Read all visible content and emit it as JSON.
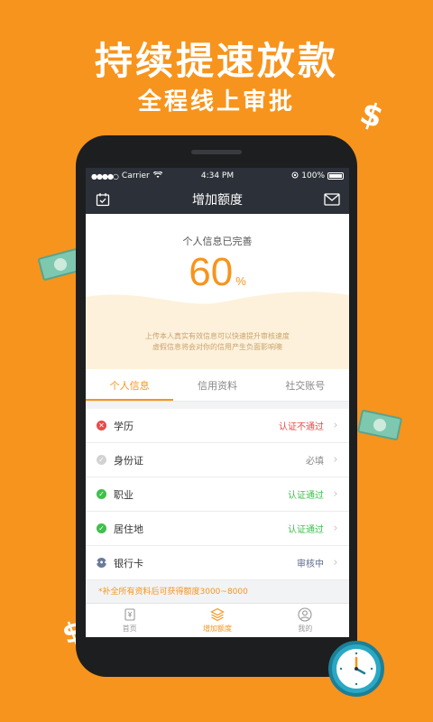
{
  "promo": {
    "headline": "持续提速放款",
    "subline": "全程线上审批"
  },
  "statusbar": {
    "signal": "●●●●○",
    "carrier": "Carrier",
    "time": "4:34 PM",
    "battery": "100%"
  },
  "navbar": {
    "title": "增加额度",
    "left_icon": "calendar-check-icon",
    "right_icon": "mail-icon"
  },
  "progress": {
    "label": "个人信息已完善",
    "value": "60",
    "unit": "%",
    "percent": 60,
    "hint_line1": "上传本人真实有效信息可以快速提升审核速度",
    "hint_line2": "虚假信息将会对你的信用产生负面影响噢"
  },
  "tabs": [
    {
      "label": "个人信息",
      "active": true
    },
    {
      "label": "信用资料",
      "active": false
    },
    {
      "label": "社交账号",
      "active": false
    }
  ],
  "items": [
    {
      "label": "学历",
      "status": "认证不通过",
      "status_color": "#e84a4a",
      "icon": "x-circle-icon",
      "icon_color": "#e84a4a"
    },
    {
      "label": "身份证",
      "status": "必填",
      "status_color": "#888888",
      "icon": "check-circle-icon",
      "icon_color": "#d2d2d2"
    },
    {
      "label": "职业",
      "status": "认证通过",
      "status_color": "#3fbf4b",
      "icon": "check-circle-icon",
      "icon_color": "#3fbf4b"
    },
    {
      "label": "居住地",
      "status": "认证通过",
      "status_color": "#3fbf4b",
      "icon": "check-circle-icon",
      "icon_color": "#3fbf4b"
    },
    {
      "label": "银行卡",
      "status": "审核中",
      "status_color": "#5b6a8a",
      "icon": "more-circle-icon",
      "icon_color": "#6b7a9a"
    }
  ],
  "footnote": "*补全所有资料后可获得额度3000~8000",
  "tabbar": [
    {
      "label": "首页",
      "icon": "home-yen-icon",
      "active": false
    },
    {
      "label": "增加额度",
      "icon": "layers-icon",
      "active": true
    },
    {
      "label": "我的",
      "icon": "user-icon",
      "active": false
    }
  ],
  "colors": {
    "brand": "#f7941d",
    "header": "#2c3038"
  }
}
